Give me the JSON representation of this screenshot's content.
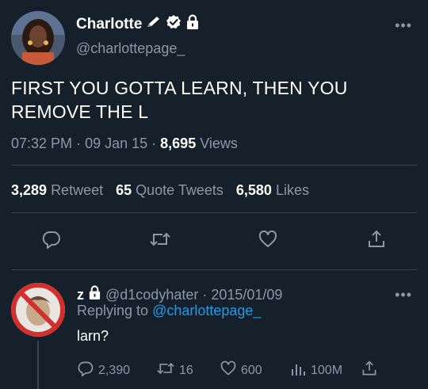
{
  "tweet": {
    "name": "Charlotte",
    "handle": "@charlottepage_",
    "text": "FIRST YOU GOTTA LEARN, THEN YOU REMOVE THE L",
    "time": "07:32 PM",
    "date": "09 Jan 15",
    "views_count": "8,695",
    "views_label": "Views",
    "retweets_count": "3,289",
    "retweets_label": "Retweet",
    "quotes_count": "65",
    "quotes_label": "Quote Tweets",
    "likes_count": "6,580",
    "likes_label": "Likes",
    "more": "•••"
  },
  "reply": {
    "name": "z",
    "handle": "@d1codyhater",
    "date": "2015/01/09",
    "replying_prefix": "Replying to",
    "replying_handle": "@charlottepage_",
    "text": "larn?",
    "replies": "2,390",
    "retweets": "16",
    "likes": "600",
    "views": "100M",
    "more": "•••"
  },
  "colors": {
    "background": "#15202b",
    "muted": "#8b98a5",
    "link": "#1d9bf0",
    "divider": "#38444d",
    "no_sign": "#d32f2f"
  },
  "icons": [
    "pencil-icon",
    "verified-badge-icon",
    "lock-icon",
    "reply-icon",
    "retweet-icon",
    "like-icon",
    "share-icon",
    "views-icon",
    "more-icon"
  ]
}
